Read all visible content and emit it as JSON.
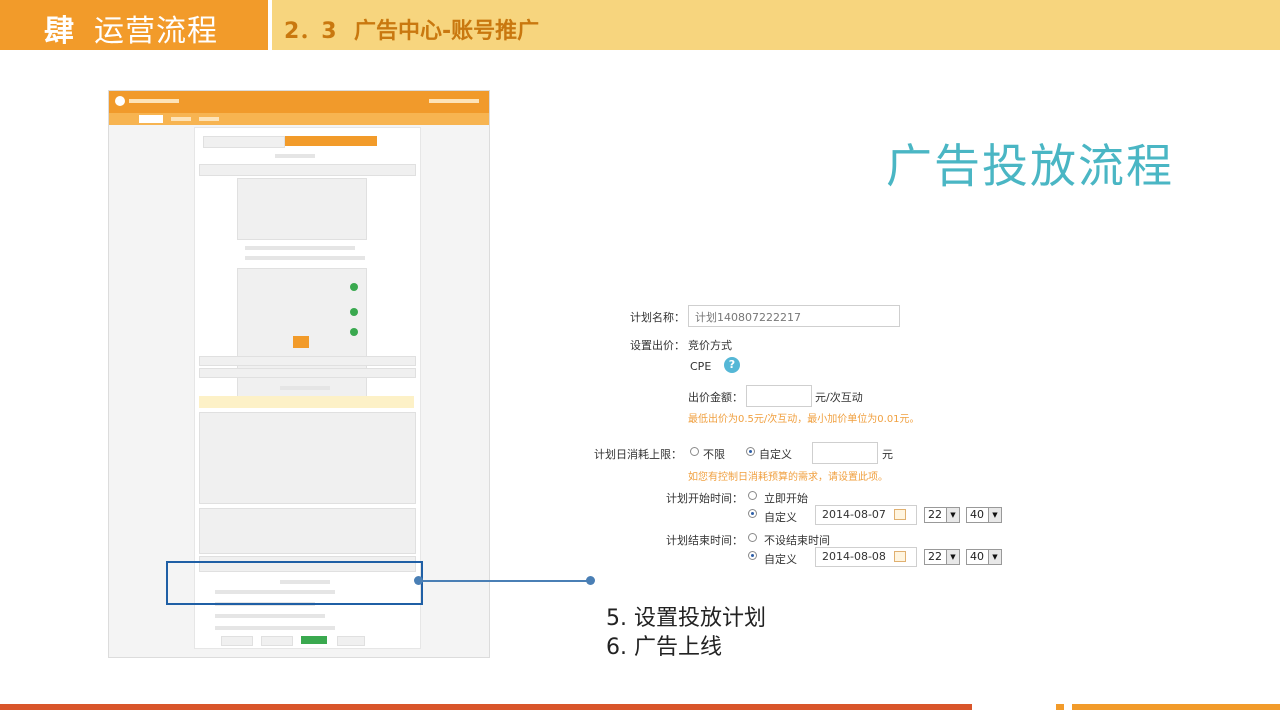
{
  "header": {
    "chapter_num": "肆",
    "chapter_title": "运营流程",
    "section_num": "2．3",
    "section_title": "广告中心-账号推广"
  },
  "big_title": "广告投放流程",
  "form": {
    "plan_name_label": "计划名称：",
    "plan_name_value": "计划140807222217",
    "bid_label": "设置出价：",
    "bid_mode": "竞价方式",
    "cpe": "CPE",
    "cpe_help": "?",
    "bid_amount_label": "出价金额：",
    "bid_unit": "元/次互动",
    "bid_hint": "最低出价为0.5元/次互动，最小加价单位为0.01元。",
    "daily_limit_label": "计划日消耗上限：",
    "daily_limit_unlimited": "不限",
    "daily_limit_custom": "自定义",
    "daily_limit_unit": "元",
    "daily_limit_hint": "如您有控制日消耗预算的需求，请设置此项。",
    "start_label": "计划开始时间：",
    "start_now": "立即开始",
    "start_custom": "自定义",
    "start_date": "2014-08-07",
    "start_hour": "22",
    "start_min": "40",
    "end_label": "计划结束时间：",
    "end_none": "不设结束时间",
    "end_custom": "自定义",
    "end_date": "2014-08-08",
    "end_hour": "22",
    "end_min": "40"
  },
  "steps": {
    "step5": "5. 设置投放计划",
    "step6": "6. 广告上线"
  },
  "colors": {
    "header_orange": "#f29b2a",
    "header_light": "#f7d57e",
    "title_teal": "#4ab6c4",
    "highlight_blue": "#1f5fa5",
    "hint_orange": "#f0a040"
  }
}
